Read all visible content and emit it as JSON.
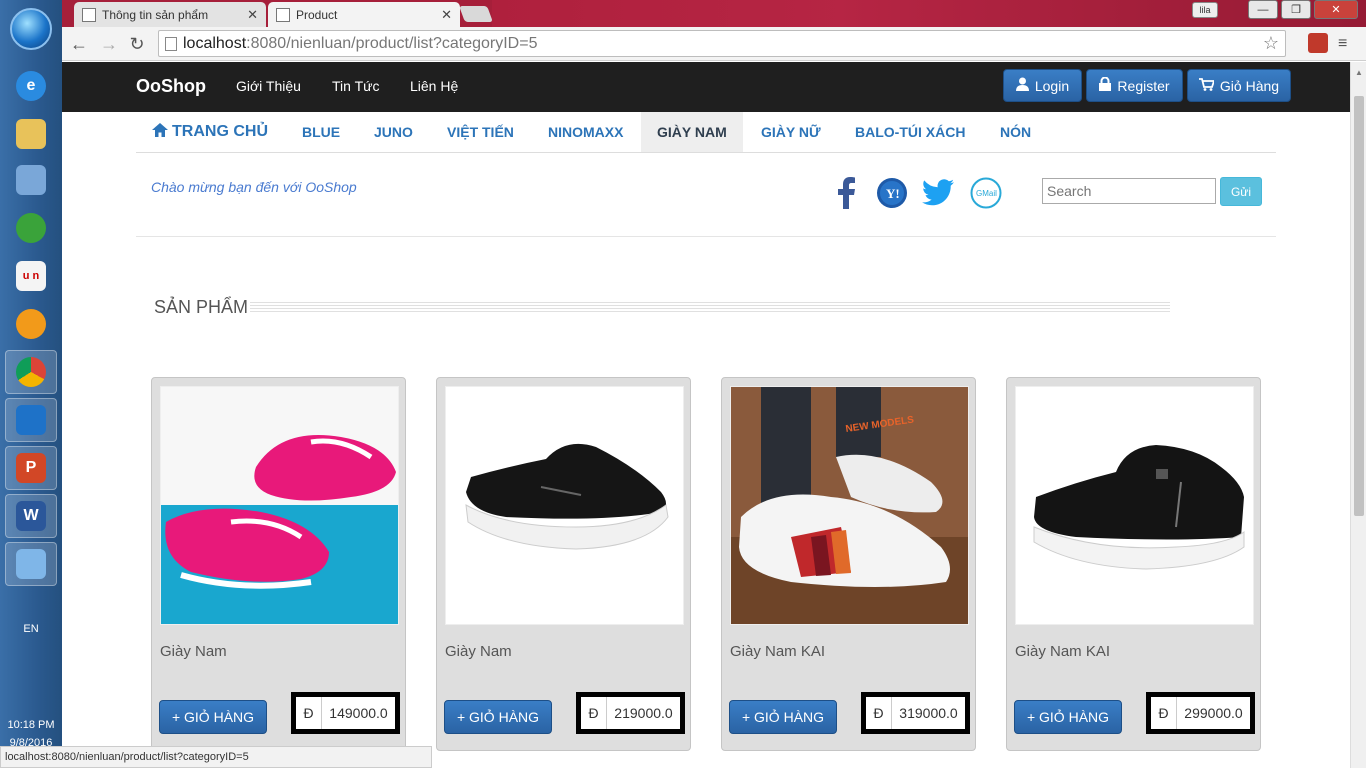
{
  "taskbar": {
    "lang": "EN",
    "time": "10:18 PM",
    "date": "9/8/2016",
    "apps": [
      "explorer-icon",
      "ie-icon",
      "folder-icon",
      "paint-icon",
      "picasa-icon",
      "unikey-icon",
      "messenger-icon",
      "chrome-icon",
      "virtualbox-icon",
      "powerpoint-icon",
      "word-icon",
      "art-icon"
    ]
  },
  "browser": {
    "tabs": [
      {
        "title": "Thông tin sản phẩm",
        "active": false
      },
      {
        "title": "Product",
        "active": true
      }
    ],
    "url_host": "localhost",
    "url_rest": ":8080/nienluan/product/list?categoryID=5",
    "status_url": "localhost:8080/nienluan/product/list?categoryID=5",
    "user_chip": "lila"
  },
  "site": {
    "brand": "OoShop",
    "nav": [
      "Giới Thiệu",
      "Tin Tức",
      "Liên Hệ"
    ],
    "login": "Login",
    "register": "Register",
    "cart": "Giỏ Hàng",
    "categories": [
      "TRANG CHỦ",
      "BLUE",
      "JUNO",
      "VIỆT TIẾN",
      "NINOMAXX",
      "GIÀY NAM",
      "GIÀY NỮ",
      "BALO-TÚI XÁCH",
      "NÓN"
    ],
    "active_category": "GIÀY NAM",
    "welcome": "Chào mừng bạn đến với OoShop",
    "search_placeholder": "Search",
    "search_button": "Gửi",
    "section_title": "SẢN PHẨM",
    "add_to_cart": "+ GIỎ HÀNG",
    "currency": "Đ"
  },
  "products": [
    {
      "name": "Giày Nam",
      "price": "149000.0"
    },
    {
      "name": "Giày Nam",
      "price": "219000.0"
    },
    {
      "name": "Giày Nam KAI",
      "price": "319000.0"
    },
    {
      "name": "Giày Nam KAI",
      "price": "299000.0"
    }
  ],
  "colors": {
    "accent": "#2c74b8",
    "navbar": "#1f1f1f",
    "button": "#2a63a4",
    "info": "#5bc0de"
  }
}
